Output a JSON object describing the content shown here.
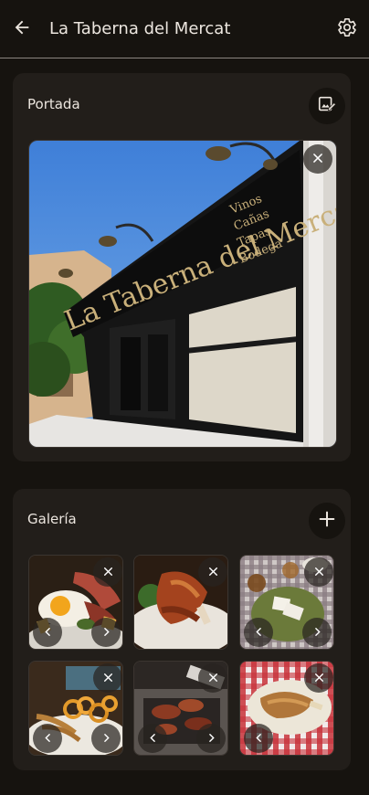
{
  "header": {
    "title": "La Taberna del Mercat",
    "back_icon": "arrow-left-icon",
    "settings_icon": "gear-icon"
  },
  "cover": {
    "label": "Portada",
    "edit_icon": "edit-image-icon",
    "remove_icon": "close-icon",
    "photo": {
      "sign_main": "La Taberna del Mercat",
      "sign_side": [
        "Vinos",
        "Cañas",
        "Tapas",
        "Bodega"
      ]
    }
  },
  "gallery": {
    "label": "Galería",
    "add_icon": "plus-icon",
    "items": [
      {
        "subject": "fried-eggs-ham"
      },
      {
        "subject": "grilled-lamb-ribs"
      },
      {
        "subject": "cheese-plate-table"
      },
      {
        "subject": "fried-squid-plate"
      },
      {
        "subject": "grill-meat"
      },
      {
        "subject": "roast-lamb-checkered"
      }
    ]
  },
  "colors": {
    "background": "#16130f",
    "card": "#221e1a",
    "text": "#ece6df",
    "divider": "#8b8580"
  }
}
